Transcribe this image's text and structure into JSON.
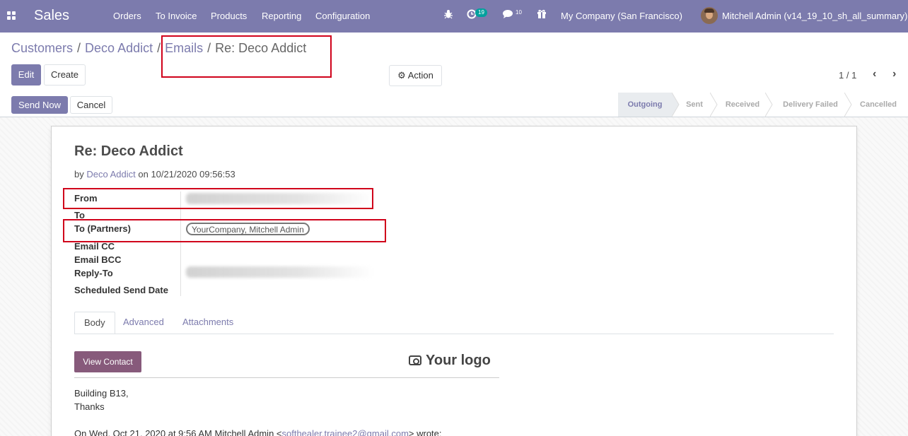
{
  "navbar": {
    "brand": "Sales",
    "menu": [
      "Orders",
      "To Invoice",
      "Products",
      "Reporting",
      "Configuration"
    ],
    "activity_badge": "19",
    "message_count": "10",
    "company": "My Company (San Francisco)",
    "user": "Mitchell Admin (v14_19_10_sh_all_summary)",
    "icons": [
      "apps-icon",
      "bug-icon",
      "clock-icon",
      "chat-icon",
      "gift-icon"
    ]
  },
  "breadcrumb": {
    "items": [
      "Customers",
      "Deco Addict",
      "Emails"
    ],
    "current": "Re: Deco Addict",
    "separator": "/"
  },
  "toolbar": {
    "edit_label": "Edit",
    "create_label": "Create",
    "action_label": "Action",
    "pager": "1 / 1"
  },
  "status": {
    "send_now_label": "Send Now",
    "cancel_label": "Cancel",
    "stages": [
      "Outgoing",
      "Sent",
      "Received",
      "Delivery Failed",
      "Cancelled"
    ],
    "current_stage": "Outgoing"
  },
  "mail": {
    "subject": "Re: Deco Addict",
    "by_prefix": "by",
    "author": "Deco Addict",
    "on_prefix": "on",
    "date": "10/21/2020 09:56:53",
    "field_labels": {
      "from": "From",
      "to": "To",
      "to_partners": "To (Partners)",
      "cc": "Email CC",
      "bcc": "Email BCC",
      "reply_to": "Reply-To",
      "scheduled": "Scheduled Send Date"
    },
    "to_partners_tag": "YourCompany, Mitchell Admin"
  },
  "tabs": [
    "Body",
    "Advanced",
    "Attachments"
  ],
  "body": {
    "view_contact_label": "View Contact",
    "logo_text": "Your logo",
    "lines": [
      "Building B13,",
      "Thanks"
    ],
    "quote_prefix": "On Wed, Oct 21, 2020 at 9:56 AM Mitchell Admin <",
    "quote_email": "softhealer.trainee2@gmail.com",
    "quote_suffix": "> wrote:"
  },
  "colors": {
    "brand": "#7c7bad",
    "highlight": "#d0021b",
    "view_contact": "#875a7b"
  }
}
